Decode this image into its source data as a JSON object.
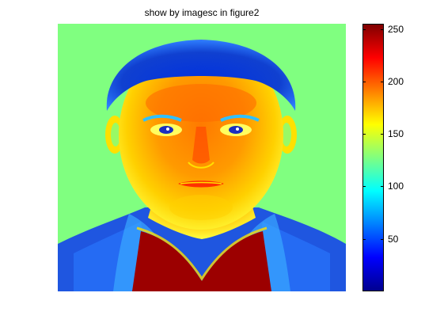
{
  "figure": {
    "title": "show by imagesc in figure2"
  },
  "colorbar": {
    "min": 0,
    "max": 255,
    "ticks": [
      "50",
      "100",
      "150",
      "200",
      "250"
    ]
  },
  "colors": {
    "background_green": "#80ff80",
    "hair_blue": "#1a3fd8",
    "skin_orange": "#ff8a00",
    "shirt_red": "#9c0000",
    "jacket_blue": "#1f56e0"
  }
}
